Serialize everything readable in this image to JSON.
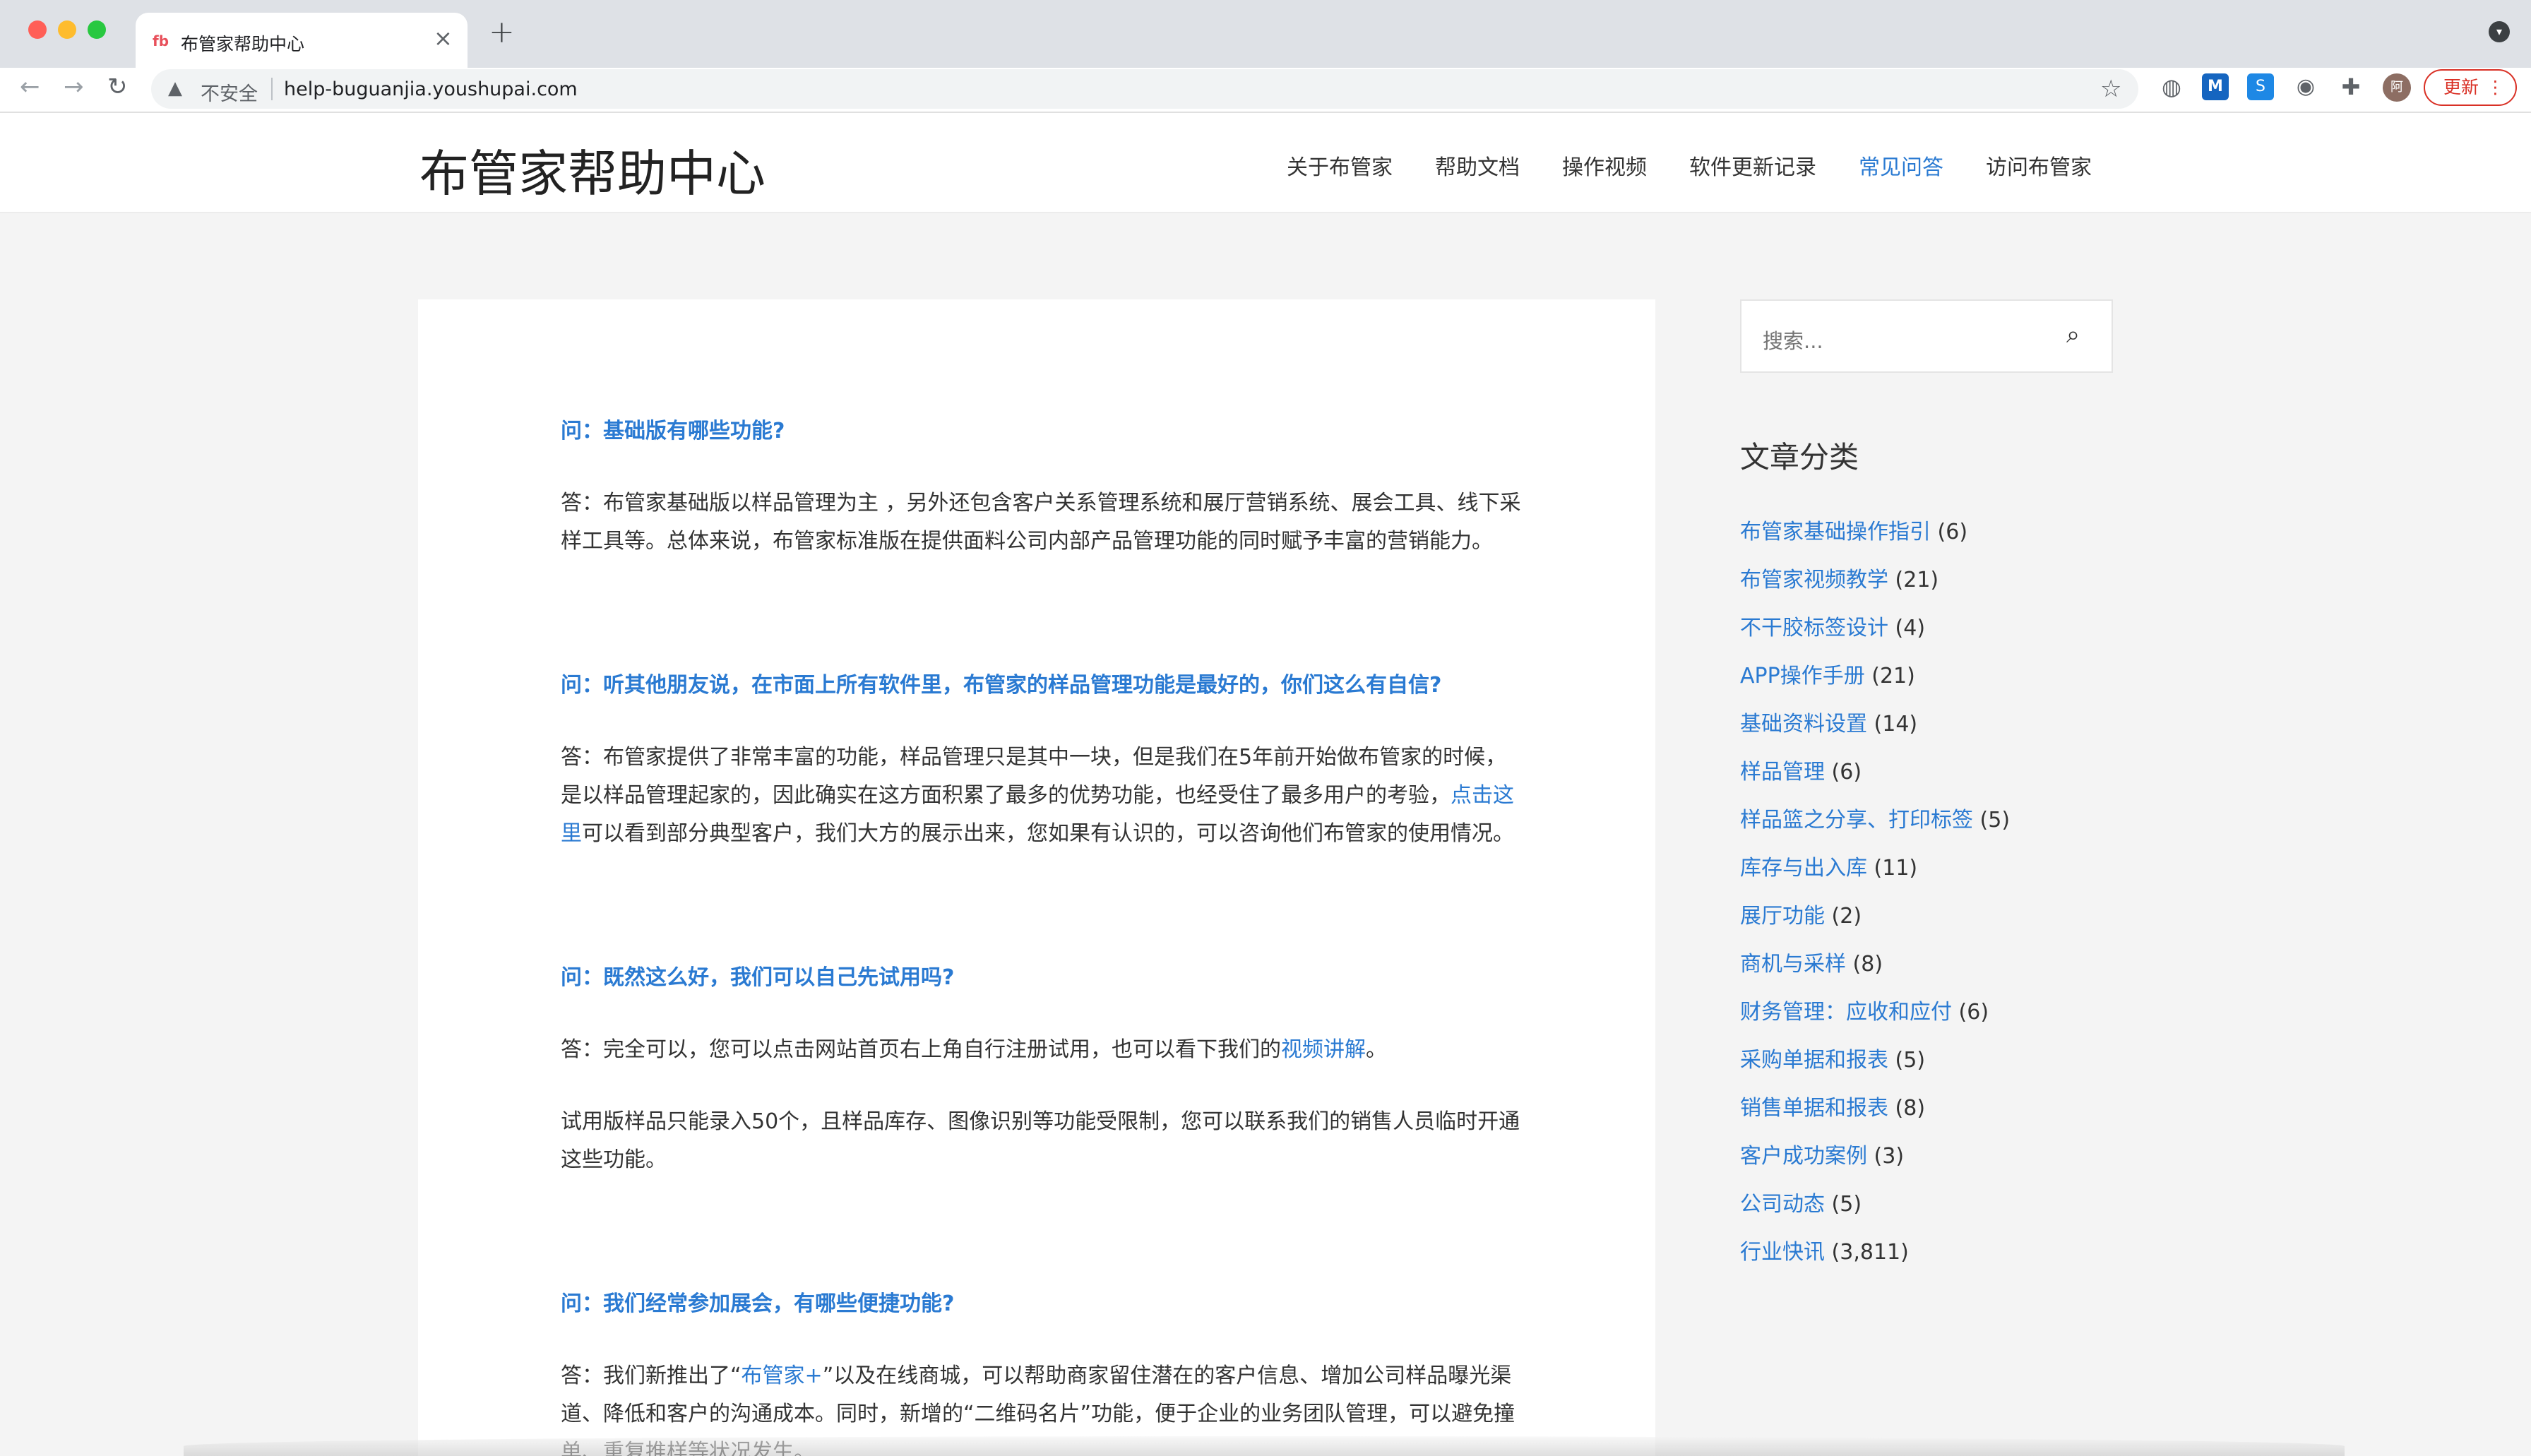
{
  "browser": {
    "tab_title": "布管家帮助中心",
    "tab_favicon": "fb",
    "tab_close": "×",
    "new_tab": "+",
    "security_label": "不安全",
    "url": "help-buguanjia.youshupai.com",
    "avatar_label": "阿",
    "update_label": "更新",
    "extension_labels": {
      "m": "M",
      "s": "S"
    },
    "icons": [
      "back-arrow-icon",
      "forward-arrow-icon",
      "reload-icon",
      "warning-icon",
      "star-icon",
      "globe-icon",
      "camera-icon",
      "puzzle-icon",
      "kebab-menu-icon"
    ]
  },
  "site": {
    "title": "布管家帮助中心",
    "nav": [
      {
        "label": "关于布管家",
        "active": false
      },
      {
        "label": "帮助文档",
        "active": false
      },
      {
        "label": "操作视频",
        "active": false
      },
      {
        "label": "软件更新记录",
        "active": false
      },
      {
        "label": "常见问答",
        "active": true
      },
      {
        "label": "访问布管家",
        "active": false
      }
    ],
    "accent_color": "#2a7ad2"
  },
  "article": {
    "qa1": {
      "q": "问：基础版有哪些功能?",
      "a": "答：布管家基础版以样品管理为主 ，另外还包含客户关系管理系统和展厅营销系统、展会工具、线下采样工具等。总体来说，布管家标准版在提供面料公司内部产品管理功能的同时赋予丰富的营销能力。"
    },
    "qa2": {
      "q": "问：听其他朋友说，在市面上所有软件里，布管家的样品管理功能是最好的，你们这么有自信?",
      "a_part1": "答：布管家提供了非常丰富的功能，样品管理只是其中一块，但是我们在5年前开始做布管家的时候，是以样品管理起家的，因此确实在这方面积累了最多的优势功能，也经受住了最多用户的考验，",
      "a_link": "点击这里",
      "a_part2": "可以看到部分典型客户，我们大方的展示出来，您如果有认识的，可以咨询他们布管家的使用情况。"
    },
    "qa3": {
      "q": "问：既然这么好，我们可以自己先试用吗?",
      "a_part1": "答：完全可以，您可以点击网站首页右上角自行注册试用，也可以看下我们的",
      "a_link": "视频讲解",
      "a_part2": "。",
      "a2": "试用版样品只能录入50个，且样品库存、图像识别等功能受限制，您可以联系我们的销售人员临时开通这些功能。"
    },
    "qa4": {
      "q": "问：我们经常参加展会，有哪些便捷功能?",
      "a_part1": "答：我们新推出了“",
      "a_link": "布管家+",
      "a_part2": "”以及在线商城，可以帮助商家留住潜在的客户信息、增加公司样品曝光渠道、降低和客户的沟通成本。同时，新增的“二维码名片”功能，便于企业的业务团队管理，可以避免撞单、重复推样等状况发生。"
    }
  },
  "sidebar": {
    "search_placeholder": "搜索...",
    "categories_title": "文章分类",
    "categories": [
      {
        "name": "布管家基础操作指引",
        "count": "(6)"
      },
      {
        "name": "布管家视频教学",
        "count": "(21)"
      },
      {
        "name": "不干胶标签设计",
        "count": "(4)"
      },
      {
        "name": "APP操作手册",
        "count": "(21)"
      },
      {
        "name": "基础资料设置",
        "count": "(14)"
      },
      {
        "name": "样品管理",
        "count": "(6)"
      },
      {
        "name": "样品篮之分享、打印标签",
        "count": "(5)"
      },
      {
        "name": "库存与出入库",
        "count": "(11)"
      },
      {
        "name": "展厅功能",
        "count": "(2)"
      },
      {
        "name": "商机与采样",
        "count": "(8)"
      },
      {
        "name": "财务管理：应收和应付",
        "count": "(6)"
      },
      {
        "name": "采购单据和报表",
        "count": "(5)"
      },
      {
        "name": "销售单据和报表",
        "count": "(8)"
      },
      {
        "name": "客户成功案例",
        "count": "(3)"
      },
      {
        "name": "公司动态",
        "count": "(5)"
      },
      {
        "name": "行业快讯",
        "count": "(3,811)"
      }
    ]
  }
}
